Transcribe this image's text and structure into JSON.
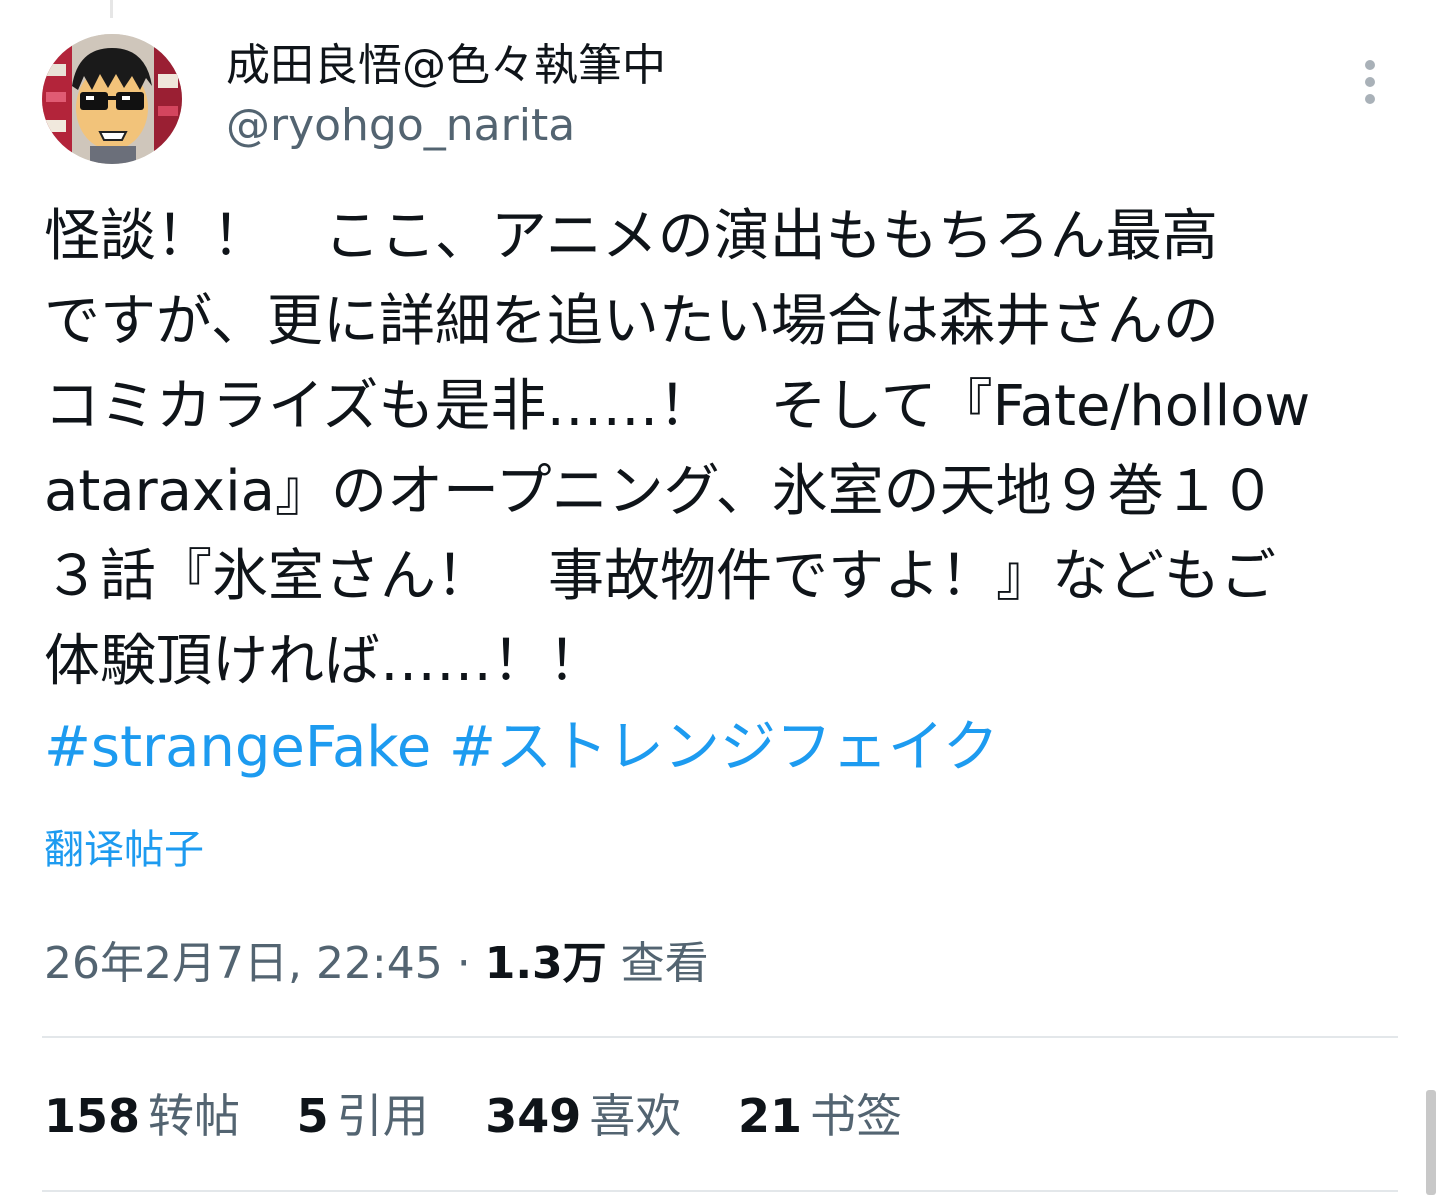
{
  "author": {
    "display_name": "成田良悟@色々執筆中",
    "handle": "@ryohgo_narita"
  },
  "tweet": {
    "lines": [
      "怪談！！　ここ、アニメの演出ももちろん最高",
      "ですが、更に詳細を追いたい場合は森井さんの",
      "コミカライズも是非……！　そして『Fate/hollow",
      "ataraxia』のオープニング、氷室の天地９巻１０",
      "３話『氷室さん！　事故物件ですよ！』などもご",
      "体験頂ければ……！！"
    ],
    "hashtags": [
      "#strangeFake",
      "#ストレンジフェイク"
    ]
  },
  "translate_label": "翻译帖子",
  "meta": {
    "timestamp": "26年2月7日, 22:45",
    "separator": " · ",
    "views_count": "1.3万",
    "views_label": "查看"
  },
  "stats": [
    {
      "count": "158",
      "label": "转帖"
    },
    {
      "count": "5",
      "label": "引用"
    },
    {
      "count": "349",
      "label": "喜欢"
    },
    {
      "count": "21",
      "label": "书签"
    }
  ]
}
